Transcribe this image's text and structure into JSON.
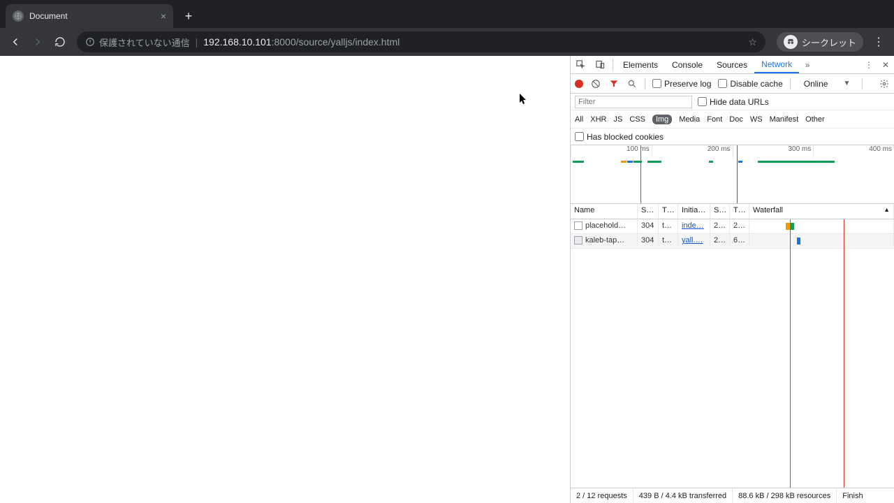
{
  "browser": {
    "tab_title": "Document",
    "close_glyph": "×",
    "newtab_glyph": "+",
    "insecure_label": "保護されていない通信",
    "url_host": "192.168.10.101",
    "url_port": ":8000",
    "url_path": "/source/yalljs/index.html",
    "incognito_label": "シークレット"
  },
  "devtools": {
    "tabs": [
      "Elements",
      "Console",
      "Sources",
      "Network"
    ],
    "more_glyph": "»",
    "preserve_log": "Preserve log",
    "disable_cache": "Disable cache",
    "throttle": "Online",
    "filter_placeholder": "Filter",
    "hide_data_urls": "Hide data URLs",
    "types": [
      "All",
      "XHR",
      "JS",
      "CSS",
      "Img",
      "Media",
      "Font",
      "Doc",
      "WS",
      "Manifest",
      "Other"
    ],
    "blocked_cookies": "Has blocked cookies",
    "timeline_ticks": [
      "100 ms",
      "200 ms",
      "300 ms",
      "400 ms"
    ],
    "columns": {
      "name": "Name",
      "status": "S…",
      "type": "T…",
      "initiator": "Initia…",
      "size": "S…",
      "time": "T…",
      "waterfall": "Waterfall"
    },
    "rows": [
      {
        "name": "placehold…",
        "status": "304",
        "type": "t…",
        "initiator": "inde…",
        "size": "2…",
        "time": "2…"
      },
      {
        "name": "kaleb-tap…",
        "status": "304",
        "type": "t…",
        "initiator": "yall.…",
        "size": "2…",
        "time": "6…"
      }
    ],
    "status": {
      "requests": "2 / 12 requests",
      "transferred": "439 B / 4.4 kB transferred",
      "resources": "88.6 kB / 298 kB resources",
      "finish": "Finish"
    }
  }
}
